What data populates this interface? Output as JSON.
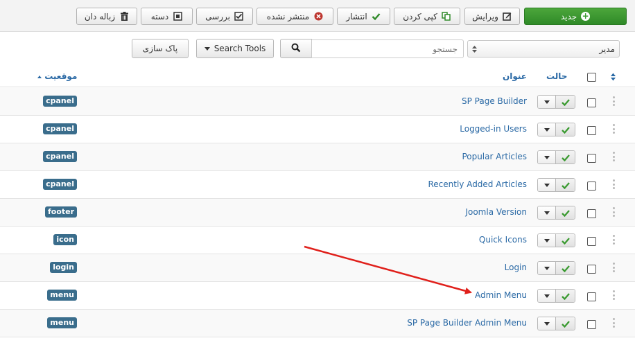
{
  "toolbar": {
    "new_label": "جدید",
    "edit_label": "ویرایش",
    "copy_label": "کپی کردن",
    "publish_label": "انتشار",
    "unpublish_label": "منتشر نشده",
    "checkin_label": "بررسی",
    "batch_label": "دسته",
    "trash_label": "زباله دان"
  },
  "filters": {
    "clear_label": "پاک سازی",
    "search_tools_label": "Search Tools",
    "search_placeholder": "جستجو",
    "client_select_value": "مدیر"
  },
  "table": {
    "col_status": "حالت",
    "col_title": "عنوان",
    "col_position": "موقعیت",
    "rows": [
      {
        "title": "SP Page Builder",
        "position": "cpanel"
      },
      {
        "title": "Logged-in Users",
        "position": "cpanel"
      },
      {
        "title": "Popular Articles",
        "position": "cpanel"
      },
      {
        "title": "Recently Added Articles",
        "position": "cpanel"
      },
      {
        "title": "Joomla Version",
        "position": "footer"
      },
      {
        "title": "Quick Icons",
        "position": "icon"
      },
      {
        "title": "Login",
        "position": "login"
      },
      {
        "title": "Admin Menu",
        "position": "menu"
      },
      {
        "title": "SP Page Builder Admin Menu",
        "position": "menu"
      }
    ]
  },
  "colors": {
    "accent": "#2a69a5",
    "badge": "#3a6d8c",
    "new_button": "#3a9a30",
    "annotation_arrow": "#e0201b",
    "published_check": "#3a9a30"
  },
  "icons": {
    "new": "plus-circle-icon",
    "edit": "edit-icon",
    "copy": "copy-icon",
    "publish": "check-icon",
    "unpublish": "x-circle-icon",
    "checkin": "checkbox-icon",
    "batch": "square-icon",
    "trash": "trash-icon",
    "search": "search-icon",
    "sort": "sort-icon",
    "drag": "drag-handle-icon"
  }
}
